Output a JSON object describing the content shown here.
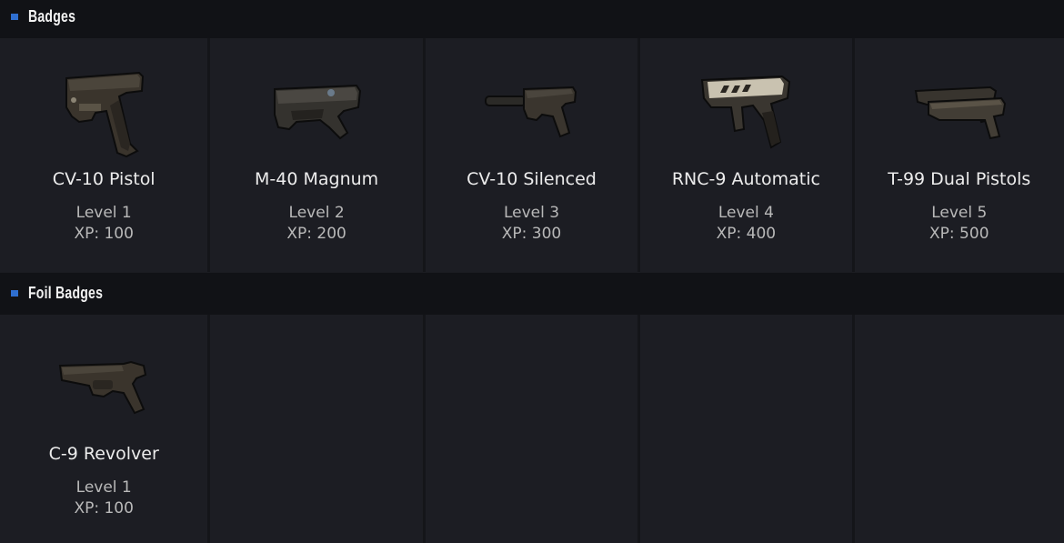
{
  "sections": [
    {
      "title": "Badges",
      "items": [
        {
          "name": "CV-10 Pistol",
          "level": "Level 1",
          "xp": "XP: 100",
          "icon": "pistol-icon"
        },
        {
          "name": "M-40 Magnum",
          "level": "Level 2",
          "xp": "XP: 200",
          "icon": "magnum-icon"
        },
        {
          "name": "CV-10 Silenced",
          "level": "Level 3",
          "xp": "XP: 300",
          "icon": "silenced-pistol-icon"
        },
        {
          "name": "RNC-9 Automatic",
          "level": "Level 4",
          "xp": "XP: 400",
          "icon": "automatic-gun-icon"
        },
        {
          "name": "T-99 Dual Pistols",
          "level": "Level 5",
          "xp": "XP: 500",
          "icon": "dual-pistols-icon"
        }
      ]
    },
    {
      "title": "Foil Badges",
      "items": [
        {
          "name": "C-9 Revolver",
          "level": "Level 1",
          "xp": "XP: 100",
          "icon": "revolver-icon"
        }
      ]
    }
  ],
  "colors": {
    "accent": "#2f6fd0",
    "background": "#1b1c21",
    "header": "#111216"
  }
}
